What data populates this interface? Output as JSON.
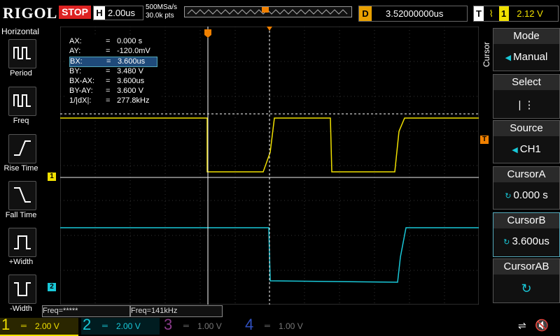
{
  "header": {
    "logo": "RIGOL",
    "run_state": "STOP",
    "h_label": "H",
    "timebase": "2.00us",
    "sample_rate": "500MSa/s",
    "points": "30.0k pts",
    "delay_label": "D",
    "delay_value": "3.52000000us",
    "trig_label": "T",
    "trig_channel": "1",
    "trig_level": "2.12 V"
  },
  "left_panel": {
    "title": "Horizontal",
    "buttons": [
      {
        "label": "Period"
      },
      {
        "label": "Freq"
      },
      {
        "label": "Rise Time"
      },
      {
        "label": "Fall Time"
      },
      {
        "label": "+Width"
      },
      {
        "label": "-Width"
      }
    ]
  },
  "readout": {
    "rows": [
      {
        "name": "AX:",
        "eq": "=",
        "value": "0.000 s"
      },
      {
        "name": "AY:",
        "eq": "=",
        "value": "-120.0mV"
      },
      {
        "name": "BX:",
        "eq": "=",
        "value": "3.600us"
      },
      {
        "name": "BY:",
        "eq": "=",
        "value": "3.480 V"
      },
      {
        "name": "BX-AX:",
        "eq": "=",
        "value": "3.600us"
      },
      {
        "name": "BY-AY:",
        "eq": "=",
        "value": "3.600 V"
      },
      {
        "name": "1/|dX|:",
        "eq": "=",
        "value": "277.8kHz"
      }
    ]
  },
  "right_panel": {
    "menu_title": "Cursor",
    "mode_title": "Mode",
    "mode_value": "Manual",
    "select_title": "Select",
    "select_value": "| ⋮",
    "source_title": "Source",
    "source_value": "CH1",
    "cursora_title": "CursorA",
    "cursora_value": "0.000 s",
    "cursorb_title": "CursorB",
    "cursorb_value": "3.600us",
    "cursorab_title": "CursorAB"
  },
  "freq": {
    "left": "Freq=*****",
    "right": "Freq=141kHz"
  },
  "channels": [
    {
      "num": "1",
      "scale": "2.00 V",
      "color": "#f0e000"
    },
    {
      "num": "2",
      "scale": "2.00 V",
      "color": "#19c8d8"
    },
    {
      "num": "3",
      "scale": "1.00 V",
      "color": "#a040a0"
    },
    {
      "num": "4",
      "scale": "1.00 V",
      "color": "#3050c0"
    }
  ],
  "markers": {
    "ch1": "1",
    "ch2": "2",
    "trig": "T"
  },
  "colors": {
    "ch1": "#f0e000",
    "ch2": "#19c8d8",
    "trigger": "#f08000",
    "stop": "#dd2222"
  }
}
